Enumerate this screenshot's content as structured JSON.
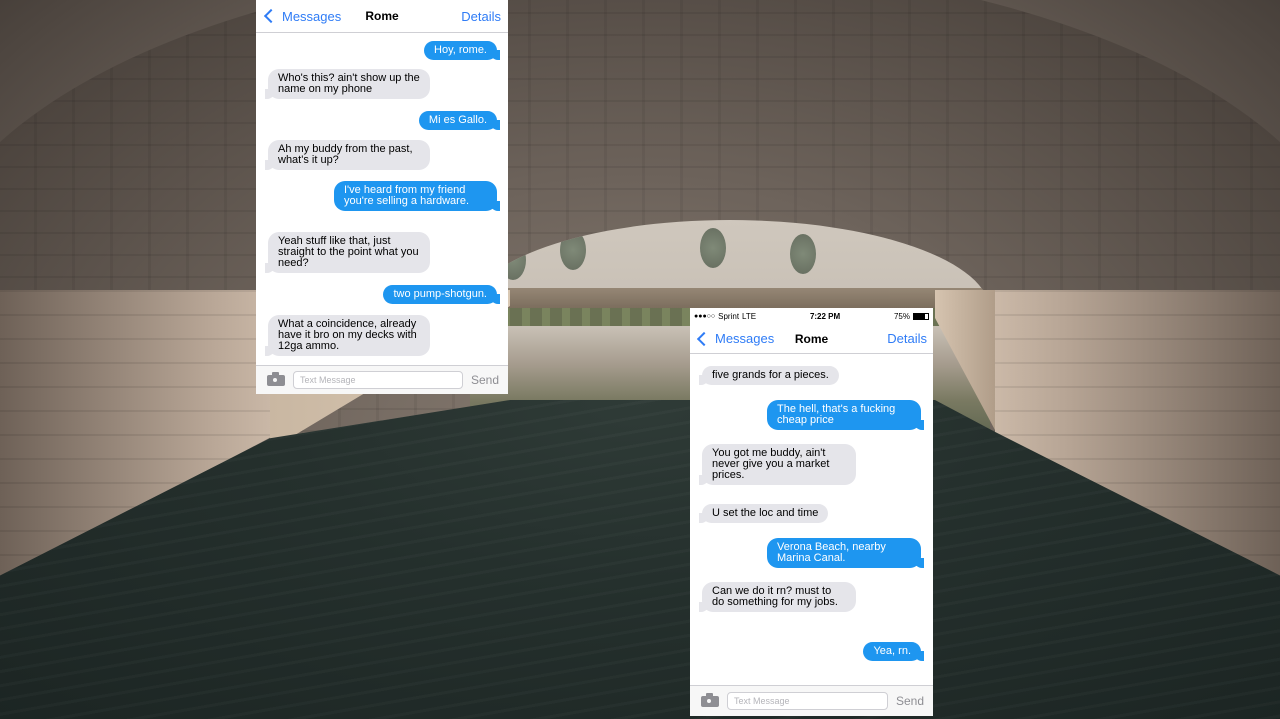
{
  "left_phone": {
    "nav": {
      "back_label": "Messages",
      "title": "Rome",
      "details_label": "Details"
    },
    "messages": [
      {
        "dir": "out",
        "text": "Hoy, rome."
      },
      {
        "dir": "in",
        "text": "Who's this? ain't show up the name on my phone"
      },
      {
        "dir": "out",
        "text": "Mi es Gallo."
      },
      {
        "dir": "in",
        "text": "Ah my buddy from the past, what's it up?"
      },
      {
        "dir": "out",
        "text": "I've heard from my friend you're selling a hardware."
      },
      {
        "dir": "in",
        "text": "Yeah stuff like that, just straight to the point what you need?"
      },
      {
        "dir": "out",
        "text": "two pump-shotgun."
      },
      {
        "dir": "in",
        "text": "What a coincidence, already have it bro on my decks with 12ga ammo."
      }
    ],
    "input": {
      "placeholder": "Text Message",
      "send_label": "Send"
    }
  },
  "right_phone": {
    "status": {
      "carrier": "Sprint",
      "network": "LTE",
      "time": "7:22 PM",
      "battery": "75%",
      "battery_level": 0.75
    },
    "nav": {
      "back_label": "Messages",
      "title": "Rome",
      "details_label": "Details"
    },
    "messages": [
      {
        "dir": "in",
        "text": "five grands for a pieces."
      },
      {
        "dir": "out",
        "text": "The hell, that's a fucking cheap price"
      },
      {
        "dir": "in",
        "text": "You got me buddy, ain't never give you a market prices."
      },
      {
        "dir": "in",
        "text": "U set the loc and time"
      },
      {
        "dir": "out",
        "text": "Verona Beach, nearby Marina Canal."
      },
      {
        "dir": "in",
        "text": "Can we do it rn? must to do something for my jobs."
      },
      {
        "dir": "out",
        "text": "Yea, rn."
      }
    ],
    "input": {
      "placeholder": "Text Message",
      "send_label": "Send"
    }
  },
  "colors": {
    "ios_blue": "#2f7cf6",
    "outgoing_bubble": "#1e96f0",
    "incoming_bubble": "#e5e5ea"
  },
  "icons": {
    "back": "chevron-left-icon",
    "camera": "camera-icon",
    "battery": "battery-icon"
  }
}
